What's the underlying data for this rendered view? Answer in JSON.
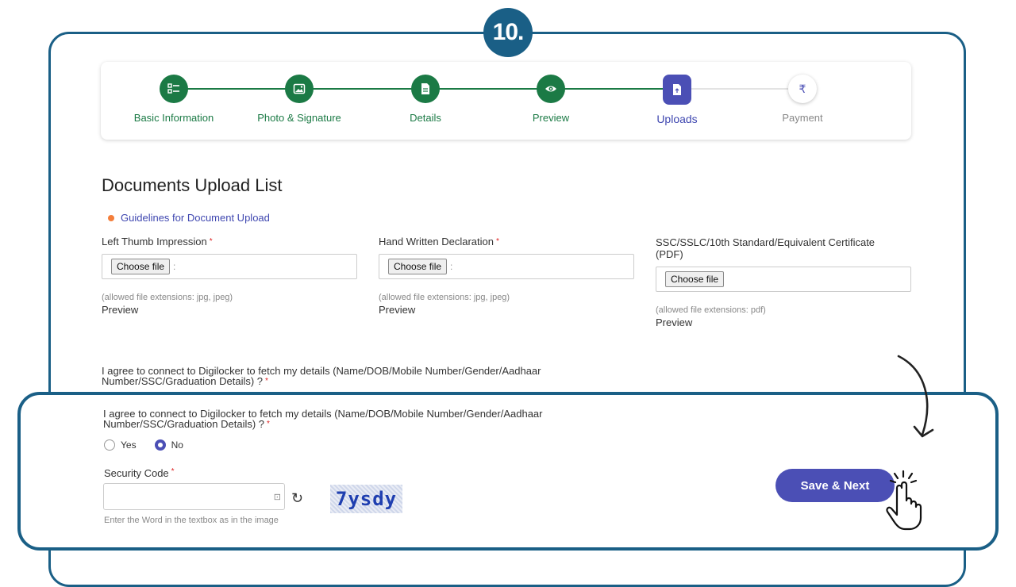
{
  "step_number": "10.",
  "stepper": {
    "steps": [
      {
        "label": "Basic Information",
        "state": "done",
        "icon": "list-icon"
      },
      {
        "label": "Photo & Signature",
        "state": "done",
        "icon": "image-icon"
      },
      {
        "label": "Details",
        "state": "done",
        "icon": "document-icon"
      },
      {
        "label": "Preview",
        "state": "done",
        "icon": "eye-icon"
      },
      {
        "label": "Uploads",
        "state": "active",
        "icon": "upload-file-icon"
      },
      {
        "label": "Payment",
        "state": "todo",
        "icon": "rupee-icon",
        "glyph": "₹"
      }
    ]
  },
  "page": {
    "title": "Documents Upload List",
    "guidelines_link": "Guidelines for Document Upload"
  },
  "uploads": [
    {
      "label": "Left Thumb Impression",
      "required": "*",
      "button": "Choose file",
      "hint": "(allowed file extensions: jpg, jpeg)",
      "preview": "Preview"
    },
    {
      "label": "Hand Written Declaration",
      "required": "*",
      "button": "Choose file",
      "hint": "(allowed file extensions: jpg, jpeg)",
      "preview": "Preview"
    },
    {
      "label": "SSC/SSLC/10th Standard/Equivalent Certificate (PDF)",
      "button": "Choose file",
      "hint": "(allowed file extensions: pdf)",
      "preview": "Preview"
    }
  ],
  "consent": {
    "question": "I agree to connect to Digilocker to fetch my details (Name/DOB/Mobile Number/Gender/Aadhaar Number/SSC/Graduation Details) ?",
    "required": "*",
    "options": [
      "Yes",
      "No"
    ],
    "selected": "No"
  },
  "security": {
    "label": "Security Code",
    "required": "*",
    "captcha": "7ysdy",
    "hint": "Enter the Word in the textbox as in the image"
  },
  "actions": {
    "save_next": "Save & Next"
  },
  "colors": {
    "frame": "#1a5f86",
    "done": "#1b7a45",
    "active": "#4b4fb5",
    "accent_dot": "#f47e3b"
  }
}
